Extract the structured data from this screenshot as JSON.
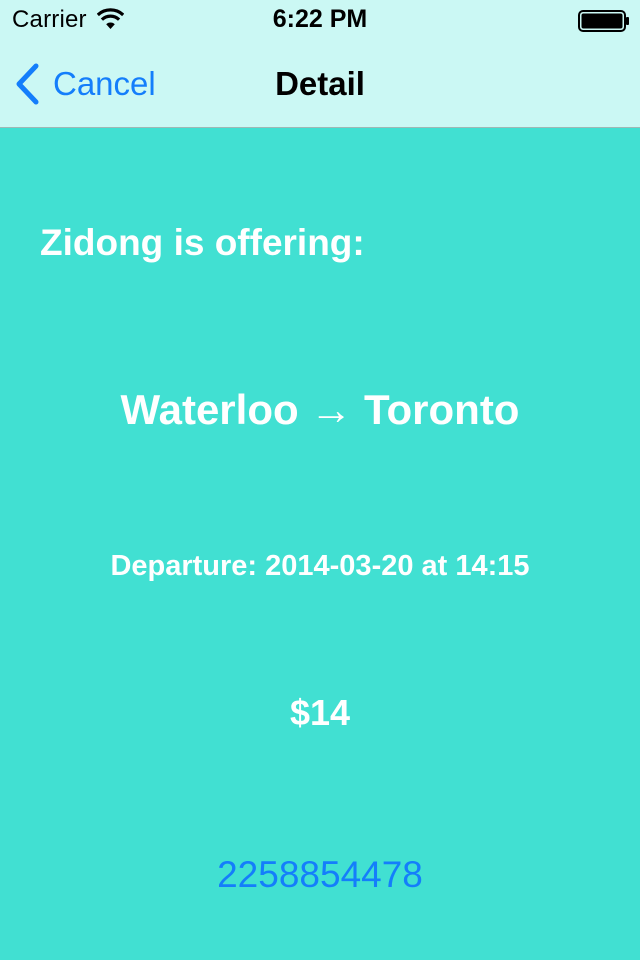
{
  "status_bar": {
    "carrier": "Carrier",
    "time": "6:22 PM",
    "wifi_icon": "wifi-icon",
    "battery_icon": "battery-icon"
  },
  "nav_bar": {
    "back_label": "Cancel",
    "back_icon": "chevron-left-icon",
    "title": "Detail"
  },
  "detail": {
    "offer_heading": "Zidong is offering:",
    "route": "Waterloo → Toronto",
    "departure": "Departure: 2014-03-20 at 14:15",
    "price": "$14",
    "phone": "2258854478"
  },
  "colors": {
    "background": "#41e0d2",
    "bar_background": "#cbf8f4",
    "accent": "#147efb",
    "text_light": "#ffffff"
  }
}
